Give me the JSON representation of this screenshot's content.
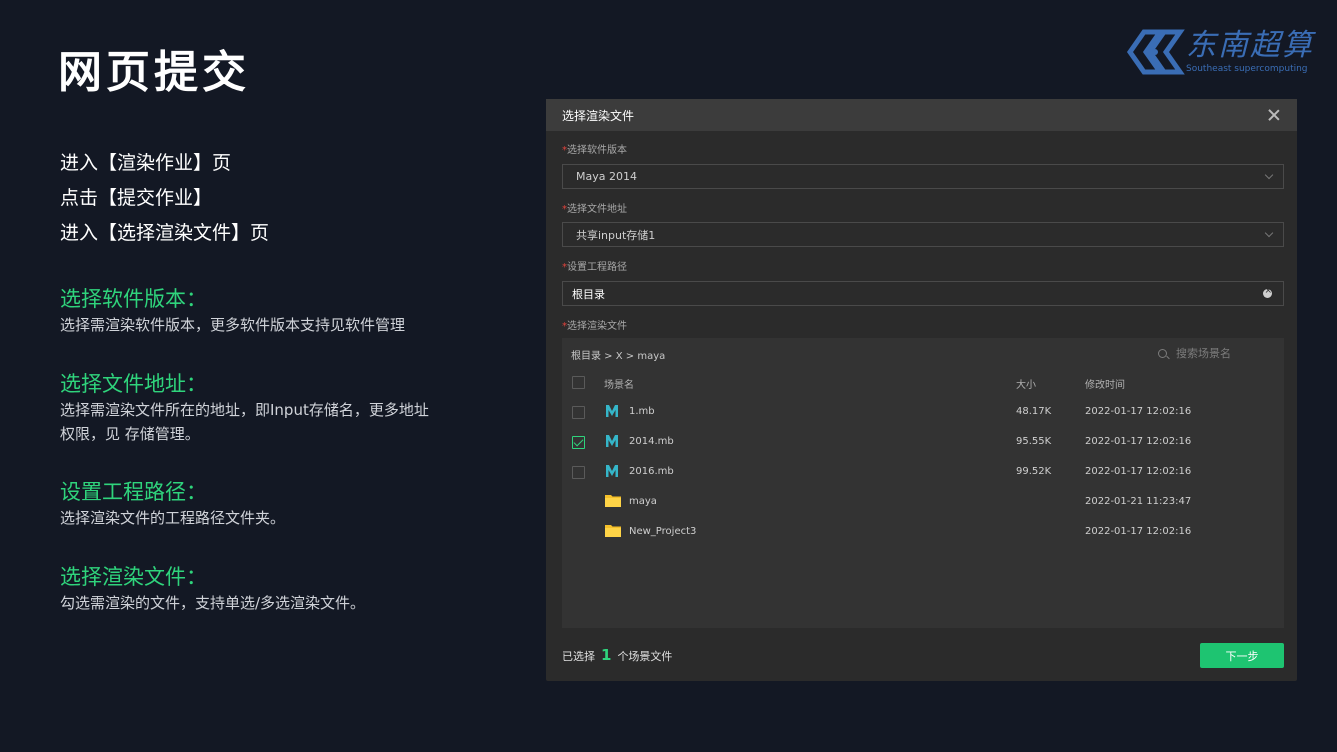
{
  "page": {
    "title": "网页提交",
    "logo": {
      "cn": "东南超算",
      "en": "Southeast supercomputing"
    },
    "steps": [
      "进入【渲染作业】页",
      "点击【提交作业】",
      "进入【选择渲染文件】页"
    ],
    "sections": [
      {
        "title": "选择软件版本：",
        "desc": "选择需渲染软件版本，更多软件版本支持见软件管理"
      },
      {
        "title": "选择文件地址：",
        "desc": "选择需渲染文件所在的地址，即Input存储名，更多地址权限，见 存储管理。"
      },
      {
        "title": "设置工程路径：",
        "desc": "选择渲染文件的工程路径文件夹。"
      },
      {
        "title": "选择渲染文件：",
        "desc": "勾选需渲染的文件，支持单选/多选渲染文件。"
      }
    ]
  },
  "dialog": {
    "title": "选择渲染文件",
    "software_label": "选择软件版本",
    "software_value": "Maya 2014",
    "storage_label": "选择文件地址",
    "storage_value": "共享input存储1",
    "project_label": "设置工程路径",
    "project_value": "根目录",
    "files_label": "选择渲染文件",
    "breadcrumb": "根目录 > X > maya",
    "search_placeholder": "搜索场景名",
    "columns": {
      "name": "场景名",
      "size": "大小",
      "time": "修改时间"
    },
    "files": [
      {
        "name": "1.mb",
        "size": "48.17K",
        "time": "2022-01-17 12:02:16",
        "type": "maya",
        "checked": false
      },
      {
        "name": "2014.mb",
        "size": "95.55K",
        "time": "2022-01-17 12:02:16",
        "type": "maya",
        "checked": true
      },
      {
        "name": "2016.mb",
        "size": "99.52K",
        "time": "2022-01-17 12:02:16",
        "type": "maya",
        "checked": false
      },
      {
        "name": "maya",
        "size": "",
        "time": "2022-01-21 11:23:47",
        "type": "folder",
        "checked": false
      },
      {
        "name": "New_Project3",
        "size": "",
        "time": "2022-01-17 12:02:16",
        "type": "folder",
        "checked": false
      }
    ],
    "selected_prefix": "已选择",
    "selected_count": "1",
    "selected_suffix": "个场景文件",
    "next_label": "下一步"
  },
  "colors": {
    "accent": "#2fd47c",
    "background": "#131824",
    "button": "#1ec471",
    "required": "#e0433c",
    "folder": "#f5c02a",
    "maya_icon": "#35b6c9"
  }
}
